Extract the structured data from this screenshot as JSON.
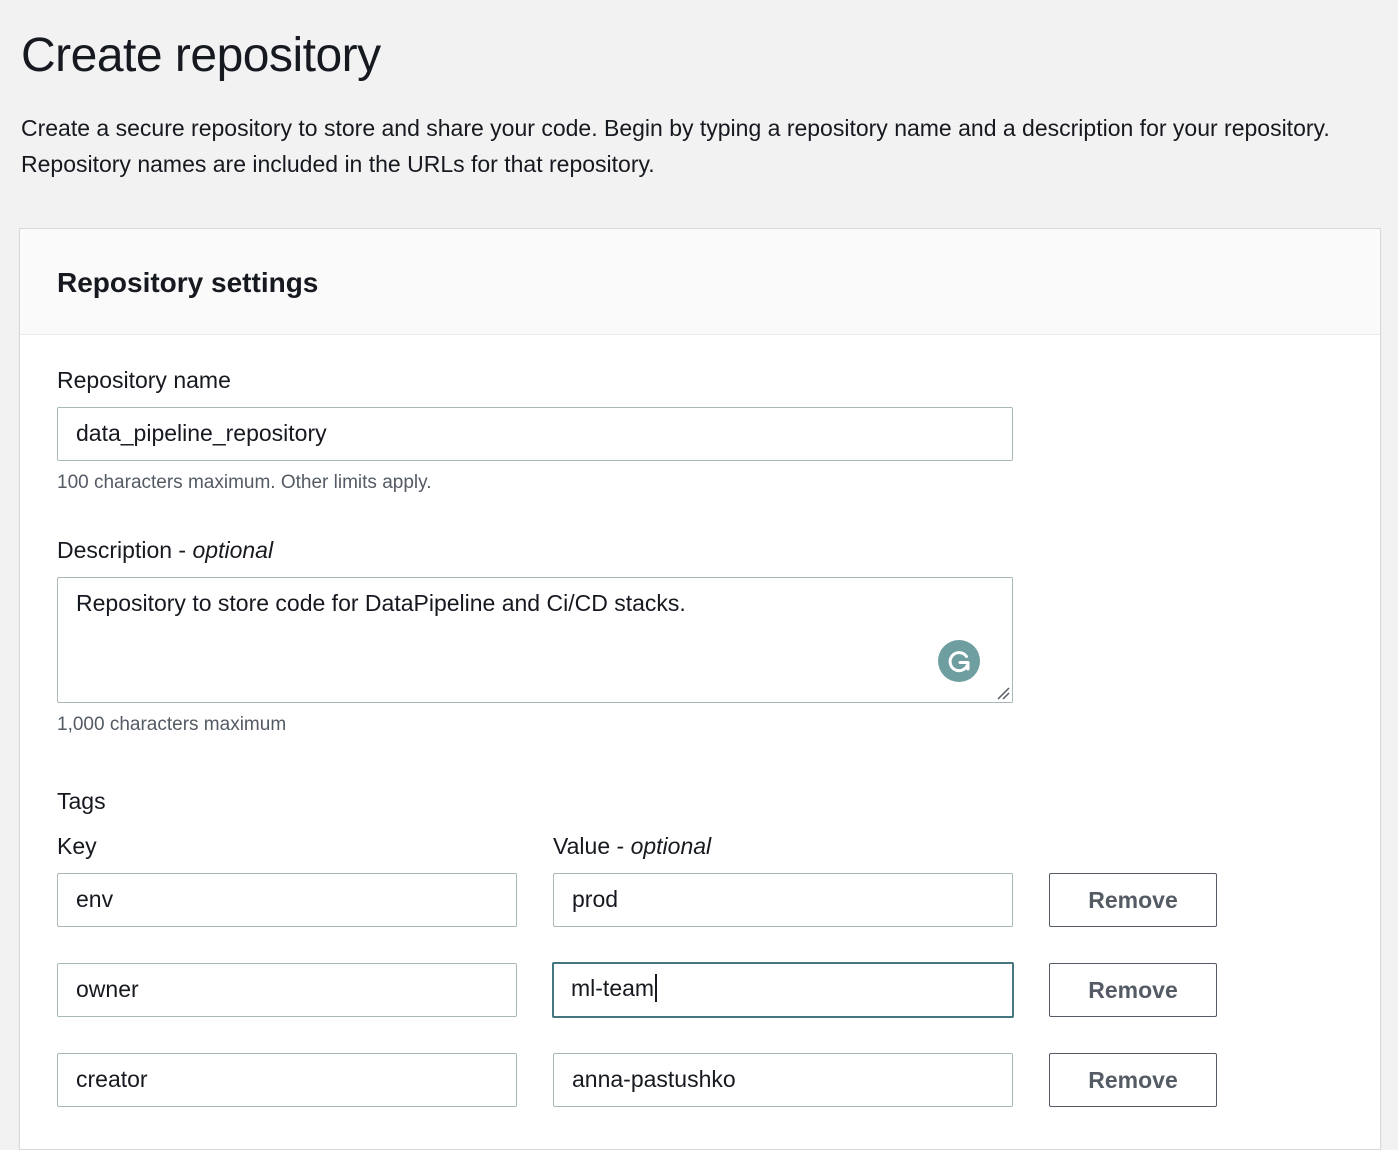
{
  "page": {
    "title": "Create repository",
    "description": "Create a secure repository to store and share your code. Begin by typing a repository name and a description for your repository. Repository names are included in the URLs for that repository."
  },
  "settings": {
    "title": "Repository settings",
    "repo_name": {
      "label": "Repository name",
      "value": "data_pipeline_repository",
      "hint": "100 characters maximum. Other limits apply."
    },
    "description": {
      "label": "Description",
      "label_suffix": "optional",
      "label_separator": " - ",
      "value": "Repository to store code for DataPipeline and Ci/CD stacks.",
      "hint": "1,000 characters maximum"
    },
    "tags": {
      "label": "Tags",
      "key_label": "Key",
      "value_label": "Value",
      "value_label_suffix": "optional",
      "label_separator": " - ",
      "remove_label": "Remove",
      "rows": [
        {
          "key": "env",
          "value": "prod"
        },
        {
          "key": "owner",
          "value": "ml-team"
        },
        {
          "key": "creator",
          "value": "anna-pastushko"
        }
      ]
    }
  },
  "colors": {
    "background": "#f2f2f2",
    "focus_border": "#44777f",
    "input_border": "#aab7b8",
    "button_text": "#545b64",
    "grammarly": "#6f9ea0"
  },
  "icons": {
    "grammarly": "grammarly-icon",
    "resize": "resize-grip-icon"
  }
}
